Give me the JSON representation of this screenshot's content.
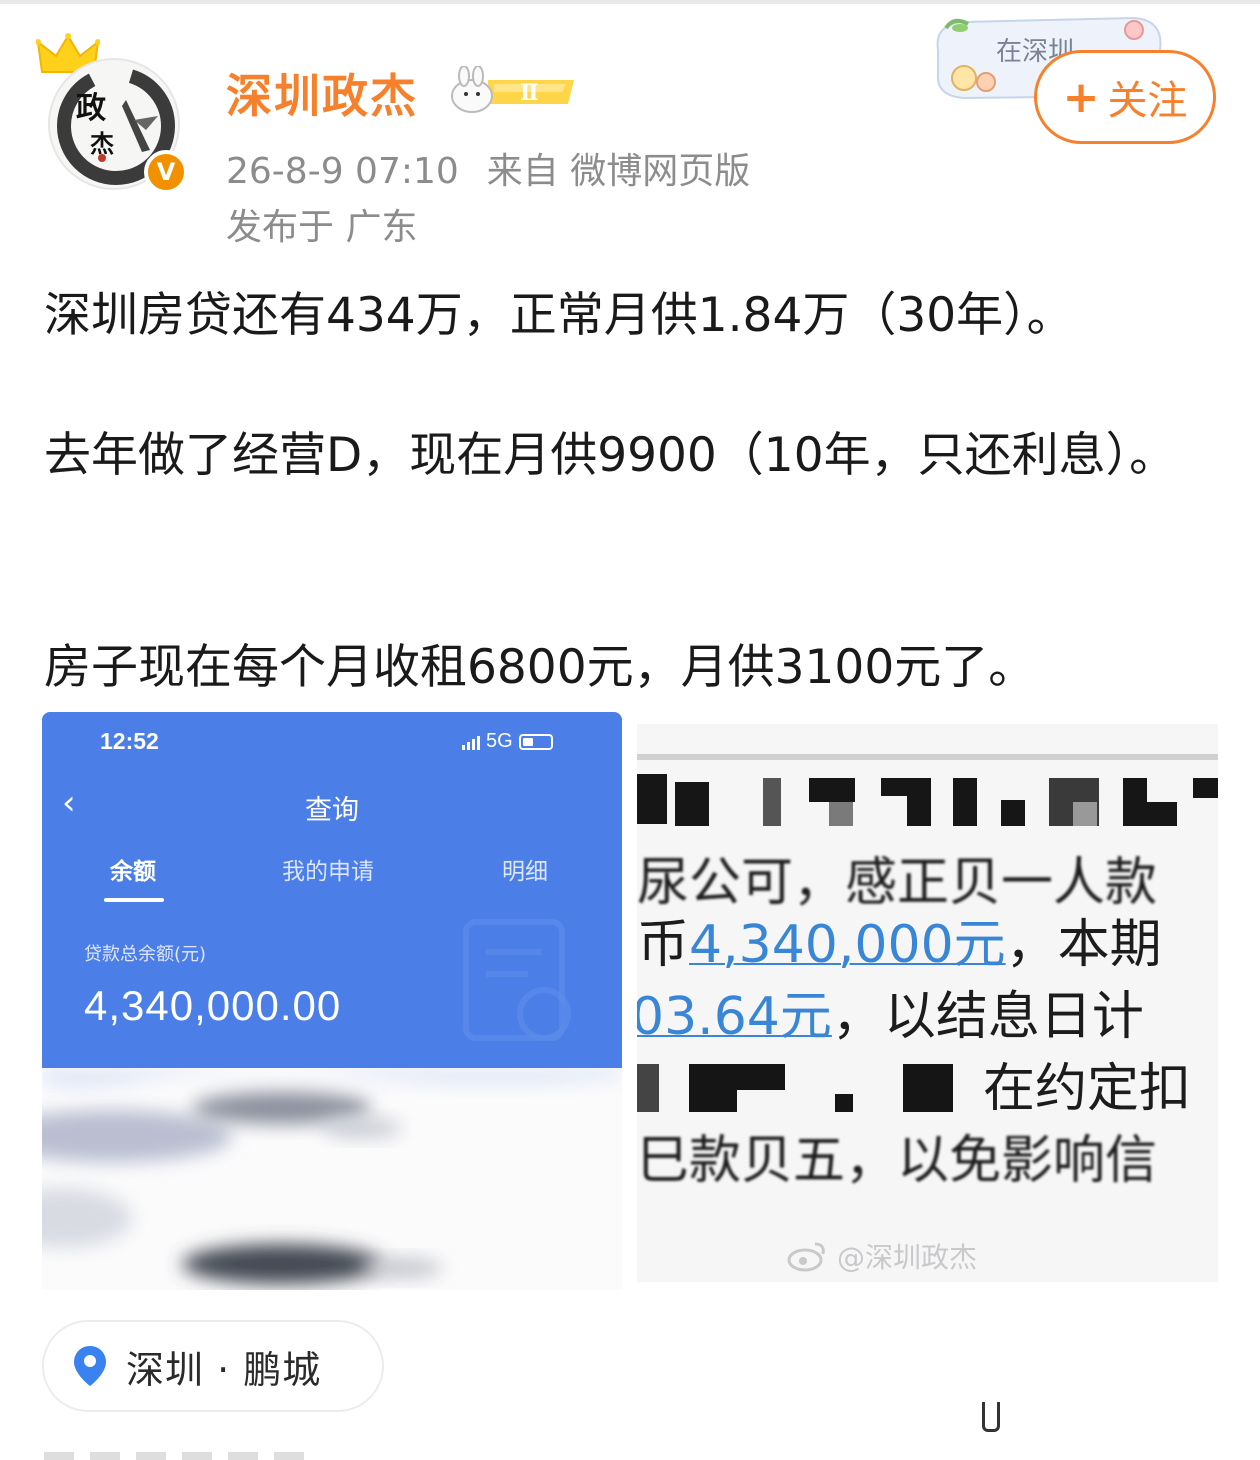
{
  "author": {
    "name": "深圳政杰",
    "level": "Ⅱ",
    "avatar_text": [
      "政",
      "杰"
    ],
    "verified_mark": "V"
  },
  "post_meta": {
    "datetime": "26-8-9 07:10",
    "source": "来自 微博网页版",
    "location_line": "发布于 广东"
  },
  "decoration_text": "在深圳",
  "follow_button": {
    "plus": "+",
    "label": "关注"
  },
  "content": {
    "para1": "深圳房贷还有434万，正常月供1.84万（30年）。",
    "para2": "去年做了经营D，现在月供9900（10年，只还利息）。",
    "para3": "房子现在每个月收租6800元，月供3100元了。"
  },
  "image1": {
    "status_time": "12:52",
    "network": "5G",
    "title": "查询",
    "tabs": [
      "余额",
      "我的申请",
      "明细"
    ],
    "active_tab": "余额",
    "balance_label": "贷款总余额(元)",
    "balance_value": "4,340,000.00"
  },
  "image2": {
    "line1": "尿公可，感正贝一人款",
    "line2_prefix": "币",
    "line2_amount": "4,340,000元",
    "line2_suffix": "，本期",
    "line3_amount": "03.64元",
    "line3_suffix": "，以结息日计",
    "line4": "在约定扣",
    "line5": "巳款贝五，以免影响信",
    "watermark": "@深圳政杰"
  },
  "location_tag": {
    "text": "深圳 · 鹏城",
    "icon": "location-pin-icon"
  },
  "colors": {
    "brand_orange": "#f7802c",
    "meta_gray": "#8c8c8c",
    "app_blue": "#4b7ee6",
    "link_blue": "#3a86d6"
  }
}
